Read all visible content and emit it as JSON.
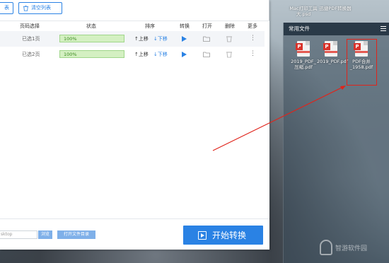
{
  "toolbar": {
    "partial_label": "表",
    "clear_label": "清空列表"
  },
  "table": {
    "headers": [
      "页码选择",
      "状态",
      "排序",
      "转换",
      "打开",
      "删除",
      "更多"
    ],
    "rows": [
      {
        "pages": "已选1页",
        "status": "100%",
        "up": "↑上移",
        "down": "↓下移"
      },
      {
        "pages": "已选2页",
        "status": "100%",
        "up": "↑上移",
        "down": "↓下移"
      }
    ]
  },
  "footer": {
    "path_value": "sktop",
    "browse_label": "浏览",
    "open_dir_label": "打开文件目录",
    "start_label": "开始转换"
  },
  "desktop": {
    "top_icons": [
      "Mac打印工具 大.psd",
      "迅捷PDF转换器"
    ],
    "panel_title": "常用文件",
    "files": [
      {
        "name": "2019_PDF_压缩.pdf"
      },
      {
        "name": "2019_PDF.pdf"
      },
      {
        "name": "PDF合并_1958.pdf"
      }
    ],
    "watermark": "智游软件园"
  },
  "colors": {
    "accent": "#2a82e4",
    "progress": "#d4f0c2",
    "highlight": "#e0241b"
  }
}
